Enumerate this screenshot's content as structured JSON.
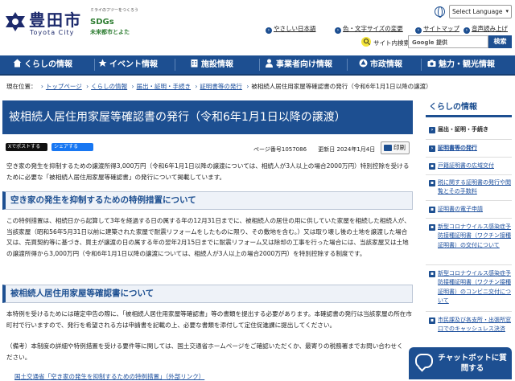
{
  "header": {
    "logo_name": "豊田市",
    "logo_en": "Toyota City",
    "sdgs_tag": "ミライのフツーをつくろう",
    "sdgs_logo": "SDGs",
    "sdgs_sub": "未来都市とよた",
    "language_select": "Select Language",
    "utility_links": [
      "やさしい日本語",
      "色・文字サイズの変更",
      "サイトマップ",
      "音声読み上げ"
    ],
    "search_label": "サイト内検索",
    "search_placeholder": "Google 提供",
    "search_button": "検索"
  },
  "nav": [
    {
      "label": "くらしの情報",
      "icon": "house-icon"
    },
    {
      "label": "イベント情報",
      "icon": "star-icon"
    },
    {
      "label": "施設情報",
      "icon": "building-icon"
    },
    {
      "label": "事業者向け情報",
      "icon": "person-icon"
    },
    {
      "label": "市政情報",
      "icon": "city-icon"
    },
    {
      "label": "魅力・観光情報",
      "icon": "camera-icon"
    }
  ],
  "breadcrumb": {
    "current_label": "現在位置：",
    "items": [
      "トップページ",
      "くらしの情報",
      "届出・証明・手続き",
      "証明書等の発行"
    ],
    "current": "被相続人居住用家屋等確認書の発行（令和6年1月1日以降の譲渡）"
  },
  "page": {
    "title": "被相続人居住用家屋等確認書の発行（令和6年1月1日以降の譲渡）",
    "share_x": "Xでポストする",
    "share_fb": "シェアする",
    "page_number": "ページ番号1057086",
    "updated": "更新日 2024年1月4日",
    "print": "印刷",
    "intro": "空き家の発生を抑制するための譲渡所得3,000万円（令和6年1月1日以降の譲渡については、相続人が3人以上の場合2000万円）特別控除を受けるために必要な「被相続人居住用家屋等確認書」の発行について掲載しています。",
    "section1_title": "空き家の発生を抑制するための特例措置について",
    "section1_text": "この特例措置は、相続日から起算して3年を経過する日の属する年の12月31日までに、被相続人の居住の用に供していた家屋を相続した相続人が、当該家屋（昭和56年5月31日以前に建築された家屋で耐震リフォームをしたものに限り、その敷地を含む。）又は取り壊し後の土地を譲渡した場合又は、売買契約等に基づき、買主が譲渡の日の属する年の翌年2月15日までに耐震リフォーム又は除却の工事を行った場合には、当該家屋又は土地の譲渡所得から3,000万円（令和6年1月1日以降の譲渡については、相続人が3人以上の場合2000万円）を特別控除する制度です。",
    "section2_title": "被相続人居住用家屋等確認書について",
    "section2_text": "本特例を受けるためには確定申告の際に、「被相続人居住用家屋等確認書」等の書類を提出する必要があります。本確認書の発行は当該家屋の所在市町村で行いますので、発行を希望される方は申請書を記載の上、必要な書類を添付して定住促進課に提出してください。",
    "note_text": "（備考）本制度の詳細や特例措置を受ける要件等に関しては、国土交通省ホームページをご確認いただくか、最寄りの税務署までお問い合わせください。",
    "pdf_link": "国土交通省「空き家の発生を抑制するための特例措置」（外部リンク）"
  },
  "sidebar": {
    "title": "くらしの情報",
    "items": [
      {
        "label": "届出・証明・手続き",
        "level": 1
      },
      {
        "label": "証明書等の発行",
        "level": 1
      },
      {
        "label": "戸籍証明書の広域交付",
        "level": 2
      },
      {
        "label": "税に関する証明書の発行や閲覧とその手数料",
        "level": 2
      },
      {
        "label": "証明書の電子申請",
        "level": 2
      },
      {
        "label": "新型コロナウイルス感染症予防接種証明書（ワクチン接種証明書）の交付について",
        "level": 2
      },
      {
        "label": "新型コロナウイルス感染症予防接種証明書（ワクチン接種証明書）のコンビニ交付について",
        "level": 2
      },
      {
        "label": "市民課及び各支所・出張所窓口でのキャッシュレス決済",
        "level": 2
      }
    ]
  },
  "chatbot": {
    "label": "チャットボットに質問する"
  }
}
